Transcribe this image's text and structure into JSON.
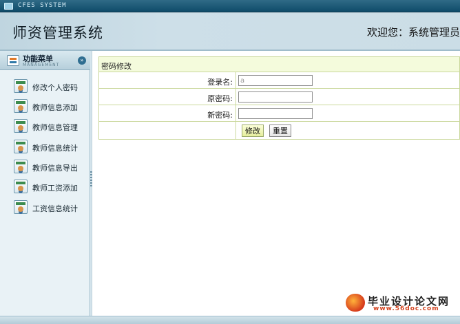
{
  "window": {
    "app_code": "CFES SYSTEM"
  },
  "header": {
    "title": "师资管理系统",
    "welcome": "欢迎您：系统管理员"
  },
  "sidebar": {
    "menu_title": "功能菜单",
    "menu_subtitle": "MANAGEMENT",
    "items": [
      {
        "label": "修改个人密码"
      },
      {
        "label": "教师信息添加"
      },
      {
        "label": "教师信息管理"
      },
      {
        "label": "教师信息统计"
      },
      {
        "label": "教师信息导出"
      },
      {
        "label": "教师工资添加"
      },
      {
        "label": "工资信息统计"
      }
    ]
  },
  "form": {
    "title": "密码修改",
    "fields": [
      {
        "label": "登录名:",
        "value": "a"
      },
      {
        "label": "原密码:",
        "value": ""
      },
      {
        "label": "新密码:",
        "value": ""
      }
    ],
    "submit_label": "修改",
    "reset_label": "重置"
  },
  "watermark": {
    "text": "毕业设计论文网",
    "url": "www.56doc.com"
  }
}
